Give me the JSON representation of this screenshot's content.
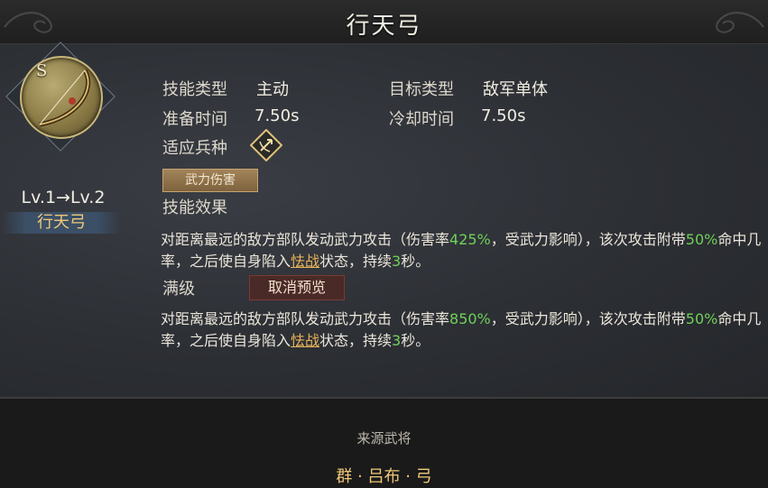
{
  "header": {
    "title": "行天弓"
  },
  "skill": {
    "grade": "S",
    "level": "Lv.1→Lv.2",
    "name": "行天弓"
  },
  "info": {
    "type_label": "技能类型",
    "type_value": "主动",
    "target_label": "目标类型",
    "target_value": "敌军单体",
    "prep_label": "准备时间",
    "prep_value": "7.50s",
    "cooldown_label": "冷却时间",
    "cooldown_value": "7.50s",
    "troop_label": "适应兵种",
    "tag": "武力伤害",
    "effect_label": "技能效果"
  },
  "effect": {
    "p1": "对距离最远的敌方部队发动武力攻击（伤害率",
    "rate": "425%",
    "p2": "，受武力影响），该次攻击附带",
    "chance": "50%",
    "p3": "命中几率，之后使自身陷入",
    "status": "怯战",
    "p4": "状态，持续",
    "duration": "3",
    "p5": "秒。"
  },
  "max": {
    "label": "满级",
    "cancel_button": "取消预览",
    "p1": "对距离最远的敌方部队发动武力攻击（伤害率",
    "rate": "850%",
    "p2": "，受武力影响），该次攻击附带",
    "chance": "50%",
    "p3": "命中几率，之后使自身陷入",
    "status": "怯战",
    "p4": "状态，持续",
    "duration": "3",
    "p5": "秒。"
  },
  "source": {
    "label": "来源武将",
    "name": "群 · 吕布 · 弓"
  },
  "colors": {
    "highlight_green": "#6fd05a",
    "highlight_gold": "#f0c879",
    "status_orange": "#e8b45a"
  }
}
